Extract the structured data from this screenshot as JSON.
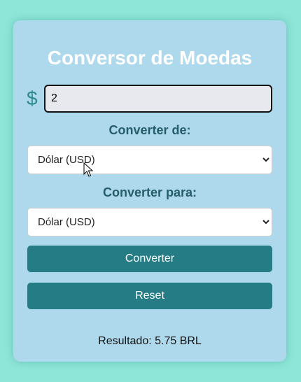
{
  "title": "Conversor de Moedas",
  "currency_symbol": "$",
  "amount": {
    "value": "2"
  },
  "from": {
    "label": "Converter de:",
    "selected": "Dólar (USD)"
  },
  "to": {
    "label": "Converter para:",
    "selected": "Dólar (USD)"
  },
  "buttons": {
    "convert": "Converter",
    "reset": "Reset"
  },
  "result": "Resultado: 5.75 BRL",
  "colors": {
    "background": "#8ee6d8",
    "card": "#aed8ec",
    "button": "#257c84",
    "label": "#255e6a",
    "title": "#ffffff"
  }
}
